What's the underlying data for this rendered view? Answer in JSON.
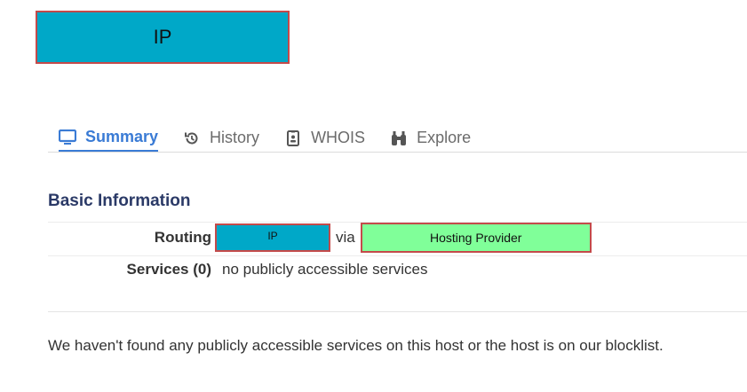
{
  "header": {
    "title": "IP"
  },
  "tabs": [
    {
      "label": "Summary",
      "icon": "monitor-icon",
      "active": true
    },
    {
      "label": "History",
      "icon": "history-icon",
      "active": false
    },
    {
      "label": "WHOIS",
      "icon": "id-card-icon",
      "active": false
    },
    {
      "label": "Explore",
      "icon": "binoculars-icon",
      "active": false
    }
  ],
  "basic_info": {
    "title": "Basic Information",
    "routing": {
      "label": "Routing",
      "ip": "IP",
      "via": "via",
      "provider": "Hosting Provider"
    },
    "services": {
      "label": "Services (0)",
      "value": "no publicly accessible services"
    }
  },
  "note": "We haven't found any publicly accessible services on this host or the host is on our blocklist.",
  "colors": {
    "accent": "#3a7bd5",
    "ip_box": "#00a8c8",
    "provider_box": "#80ff99",
    "box_border": "#c44a4a",
    "section_title": "#2b3a67"
  }
}
